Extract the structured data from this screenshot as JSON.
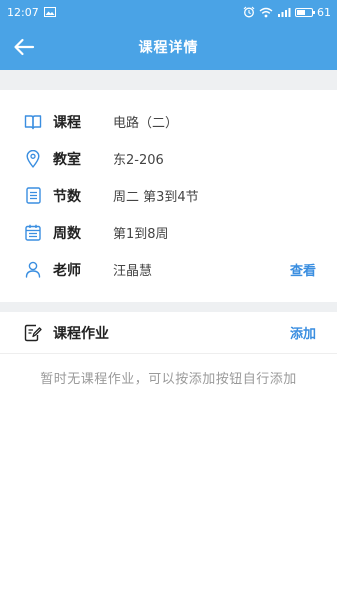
{
  "status_bar": {
    "time": "12:07",
    "battery_text": "61",
    "battery_level": 0.61,
    "icons": [
      "image-icon",
      "alarm-icon",
      "wifi-icon",
      "signal-icon",
      "battery-icon"
    ]
  },
  "app_bar": {
    "title": "课程详情",
    "back_icon": "arrow-left-icon"
  },
  "details": {
    "course": {
      "label": "课程",
      "value": "电路（二）",
      "icon": "book-icon"
    },
    "classroom": {
      "label": "教室",
      "value": "东2-206",
      "icon": "location-pin-icon"
    },
    "periods": {
      "label": "节数",
      "value": "周二 第3到4节",
      "icon": "list-icon"
    },
    "weeks": {
      "label": "周数",
      "value": "第1到8周",
      "icon": "calendar-icon"
    },
    "teacher": {
      "label": "老师",
      "value": "汪晶慧",
      "icon": "person-icon",
      "action": "查看"
    }
  },
  "homework": {
    "title": "课程作业",
    "icon": "edit-note-icon",
    "add_label": "添加",
    "empty_hint": "暂时无课程作业，可以按添加按钮自行添加"
  },
  "colors": {
    "primary": "#4aa3e6",
    "icon": "#3a8ee0",
    "divider": "#eef0f2"
  }
}
